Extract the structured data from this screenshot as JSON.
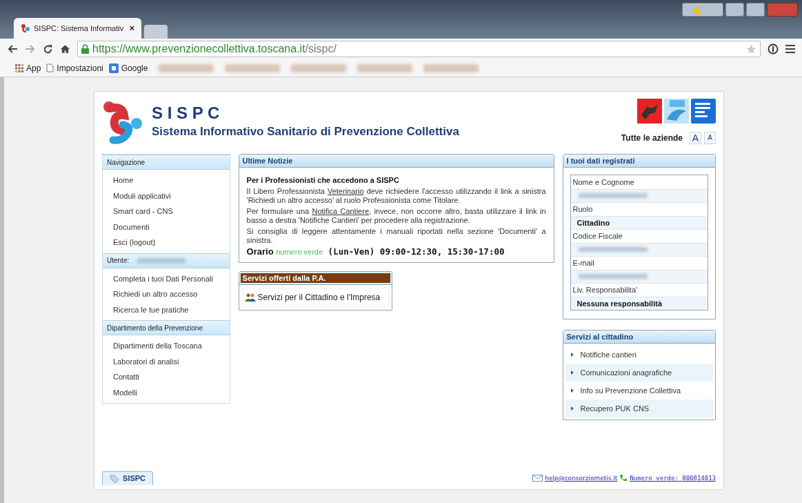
{
  "browser": {
    "tab_title": "SISPC: Sistema Informativ",
    "tab_close": "×",
    "url_host": "https://www.prevenzionecollettiva.toscana.it",
    "url_path": "/sispc/",
    "bookmarks": [
      {
        "kind": "apps",
        "label": "App"
      },
      {
        "kind": "page",
        "label": "Impostazioni"
      },
      {
        "kind": "google",
        "label": "Google"
      },
      {
        "kind": "blurred"
      },
      {
        "kind": "blurred"
      },
      {
        "kind": "blurred"
      },
      {
        "kind": "blurred"
      },
      {
        "kind": "blurred"
      }
    ]
  },
  "header": {
    "title": "S I S P C",
    "subtitle": "Sistema Informativo Sanitario di Prevenzione Collettiva",
    "aziende": "Tutte le aziende",
    "font_bigger": "A",
    "font_smaller": "A"
  },
  "sidebar": {
    "sections": [
      {
        "title": "Navigazione",
        "user_blurred": false,
        "items": [
          "Home",
          "Moduli applicativi",
          "Smart card - CNS",
          "Documenti",
          "Esci (logout)"
        ]
      },
      {
        "title": "Utente:",
        "user_blurred": true,
        "items": [
          "Completa i tuoi Dati Personali",
          "Richiedi un altro accesso",
          "Ricerca le tue pratiche"
        ]
      },
      {
        "title": "Dipartimento della Prevenzione",
        "user_blurred": false,
        "items": [
          "Dipartimenti della Toscana",
          "Laboratori di analisi",
          "Contatti",
          "Modelli"
        ]
      }
    ]
  },
  "news": {
    "title": "Ultime Notizie",
    "heading": "Per i Professionisti che accedono a SISPC",
    "paragraphs": [
      [
        {
          "kind": "text",
          "text": "Il Libero Professionista "
        },
        {
          "kind": "link",
          "text": "Veterinario"
        },
        {
          "kind": "text",
          "text": " deve richiedere l'accesso utilizzando il link a sinistra 'Richiedi un altro accesso' al ruolo Professionista come Titolare."
        }
      ],
      [
        {
          "kind": "text",
          "text": "Per formulare una "
        },
        {
          "kind": "link",
          "text": "Notifica Cantiere"
        },
        {
          "kind": "text",
          "text": ", invece, non occorre altro, basta utilizzare il link in basso a destra 'Notifiche Cantieri' per procedere alla registrazione."
        }
      ],
      [
        {
          "kind": "text",
          "text": "Si consiglia di leggere attentamente i manuali riportati nella sezione 'Documenti' a sinistra."
        }
      ]
    ],
    "hours": [
      {
        "kind": "bold",
        "text": "Orario "
      },
      {
        "kind": "green",
        "text": "numero verde"
      },
      {
        "kind": "mono",
        "text": " (Lun-Ven) 09:00-12:30, 15:30-17:00"
      }
    ]
  },
  "services_pa": {
    "title": "Servizi offerti dalla P.A.",
    "items": [
      "Servizi per il Cittadino e l'Impresa"
    ]
  },
  "user_data": {
    "title": "I tuoi dati registrati",
    "rows": [
      {
        "kind": "label",
        "text": "Nome e Cognome"
      },
      {
        "kind": "blurred"
      },
      {
        "kind": "label",
        "text": "Ruolo"
      },
      {
        "kind": "value",
        "text": "Cittadino"
      },
      {
        "kind": "label",
        "text": "Codice Fiscale"
      },
      {
        "kind": "blurred"
      },
      {
        "kind": "label",
        "text": "E-mail"
      },
      {
        "kind": "blurred"
      },
      {
        "kind": "label",
        "text": "Liv. Responsabilita'"
      },
      {
        "kind": "value",
        "text": "Nessuna responsabilità"
      }
    ]
  },
  "citizen_services": {
    "title": "Servizi al cittadino",
    "items": [
      "Notifiche cantieri",
      "Comunicazioni anagrafiche",
      "Info su Prevenzione Collettiva",
      "Recupero PUK CNS"
    ]
  },
  "footer": {
    "tab": "SISPC",
    "email": "help@consorziometis.it",
    "phone": "Numero verde: 800814013"
  }
}
